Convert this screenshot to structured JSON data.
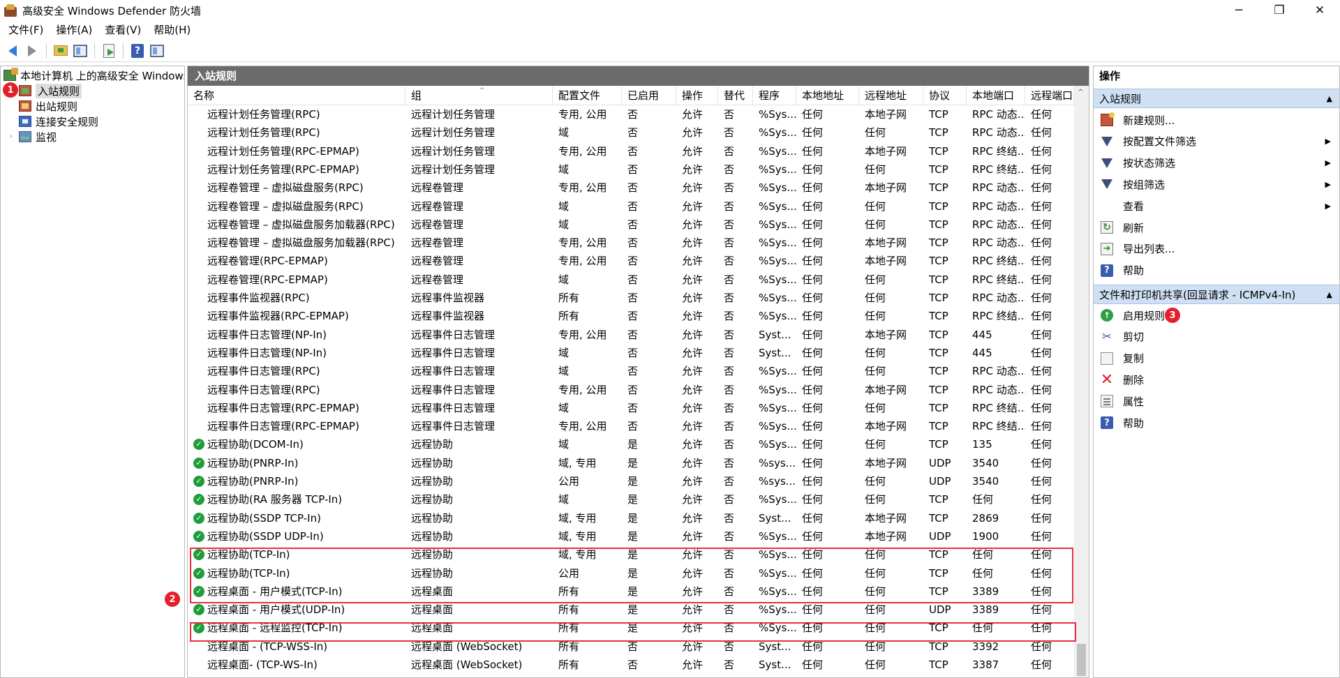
{
  "window": {
    "title": "高级安全 Windows Defender 防火墙",
    "minimize_glyph": "─",
    "maximize_glyph": "❐",
    "close_glyph": "✕"
  },
  "menu": [
    "文件(F)",
    "操作(A)",
    "查看(V)",
    "帮助(H)"
  ],
  "toolbar": {
    "icons": [
      "back-arrow-icon",
      "forward-arrow-icon",
      "up-folder-icon",
      "show-hide-tree-icon",
      "export-list-icon",
      "help-icon",
      "show-hide-action-pane-icon"
    ]
  },
  "tree": {
    "root": "本地计算机 上的高级安全 Windows Defender 防火墙",
    "items": [
      {
        "label": "入站规则",
        "icon": "inbound-rules-icon",
        "selected": true
      },
      {
        "label": "出站规则",
        "icon": "outbound-rules-icon"
      },
      {
        "label": "连接安全规则",
        "icon": "connection-security-icon"
      },
      {
        "label": "监视",
        "icon": "monitor-icon",
        "expander": "›"
      }
    ]
  },
  "annotations": {
    "badge1": "1",
    "badge2": "2",
    "badge3": "3",
    "highlight_color": "#e5303a"
  },
  "center": {
    "title": "入站规则",
    "columns": [
      "名称",
      "组",
      "配置文件",
      "已启用",
      "操作",
      "替代",
      "程序",
      "本地地址",
      "远程地址",
      "协议",
      "本地端口",
      "远程端口"
    ],
    "rows": [
      {
        "enabled_icon": false,
        "cells": [
          "远程计划任务管理(RPC)",
          "远程计划任务管理",
          "专用, 公用",
          "否",
          "允许",
          "否",
          "%Sys...",
          "任何",
          "本地子网",
          "TCP",
          "RPC 动态...",
          "任何"
        ]
      },
      {
        "enabled_icon": false,
        "cells": [
          "远程计划任务管理(RPC)",
          "远程计划任务管理",
          "域",
          "否",
          "允许",
          "否",
          "%Sys...",
          "任何",
          "任何",
          "TCP",
          "RPC 动态...",
          "任何"
        ]
      },
      {
        "enabled_icon": false,
        "cells": [
          "远程计划任务管理(RPC-EPMAP)",
          "远程计划任务管理",
          "专用, 公用",
          "否",
          "允许",
          "否",
          "%Sys...",
          "任何",
          "本地子网",
          "TCP",
          "RPC 终结...",
          "任何"
        ]
      },
      {
        "enabled_icon": false,
        "cells": [
          "远程计划任务管理(RPC-EPMAP)",
          "远程计划任务管理",
          "域",
          "否",
          "允许",
          "否",
          "%Sys...",
          "任何",
          "任何",
          "TCP",
          "RPC 终结...",
          "任何"
        ]
      },
      {
        "enabled_icon": false,
        "cells": [
          "远程卷管理 – 虚拟磁盘服务(RPC)",
          "远程卷管理",
          "专用, 公用",
          "否",
          "允许",
          "否",
          "%Sys...",
          "任何",
          "本地子网",
          "TCP",
          "RPC 动态...",
          "任何"
        ]
      },
      {
        "enabled_icon": false,
        "cells": [
          "远程卷管理 – 虚拟磁盘服务(RPC)",
          "远程卷管理",
          "域",
          "否",
          "允许",
          "否",
          "%Sys...",
          "任何",
          "任何",
          "TCP",
          "RPC 动态...",
          "任何"
        ]
      },
      {
        "enabled_icon": false,
        "cells": [
          "远程卷管理 – 虚拟磁盘服务加载器(RPC)",
          "远程卷管理",
          "域",
          "否",
          "允许",
          "否",
          "%Sys...",
          "任何",
          "任何",
          "TCP",
          "RPC 动态...",
          "任何"
        ]
      },
      {
        "enabled_icon": false,
        "cells": [
          "远程卷管理 – 虚拟磁盘服务加载器(RPC)",
          "远程卷管理",
          "专用, 公用",
          "否",
          "允许",
          "否",
          "%Sys...",
          "任何",
          "本地子网",
          "TCP",
          "RPC 动态...",
          "任何"
        ]
      },
      {
        "enabled_icon": false,
        "cells": [
          "远程卷管理(RPC-EPMAP)",
          "远程卷管理",
          "专用, 公用",
          "否",
          "允许",
          "否",
          "%Sys...",
          "任何",
          "本地子网",
          "TCP",
          "RPC 终结...",
          "任何"
        ]
      },
      {
        "enabled_icon": false,
        "cells": [
          "远程卷管理(RPC-EPMAP)",
          "远程卷管理",
          "域",
          "否",
          "允许",
          "否",
          "%Sys...",
          "任何",
          "任何",
          "TCP",
          "RPC 终结...",
          "任何"
        ]
      },
      {
        "enabled_icon": false,
        "cells": [
          "远程事件监视器(RPC)",
          "远程事件监视器",
          "所有",
          "否",
          "允许",
          "否",
          "%Sys...",
          "任何",
          "任何",
          "TCP",
          "RPC 动态...",
          "任何"
        ]
      },
      {
        "enabled_icon": false,
        "cells": [
          "远程事件监视器(RPC-EPMAP)",
          "远程事件监视器",
          "所有",
          "否",
          "允许",
          "否",
          "%Sys...",
          "任何",
          "任何",
          "TCP",
          "RPC 终结...",
          "任何"
        ]
      },
      {
        "enabled_icon": false,
        "cells": [
          "远程事件日志管理(NP-In)",
          "远程事件日志管理",
          "专用, 公用",
          "否",
          "允许",
          "否",
          "Syst...",
          "任何",
          "本地子网",
          "TCP",
          "445",
          "任何"
        ]
      },
      {
        "enabled_icon": false,
        "cells": [
          "远程事件日志管理(NP-In)",
          "远程事件日志管理",
          "域",
          "否",
          "允许",
          "否",
          "Syst...",
          "任何",
          "任何",
          "TCP",
          "445",
          "任何"
        ]
      },
      {
        "enabled_icon": false,
        "cells": [
          "远程事件日志管理(RPC)",
          "远程事件日志管理",
          "域",
          "否",
          "允许",
          "否",
          "%Sys...",
          "任何",
          "任何",
          "TCP",
          "RPC 动态...",
          "任何"
        ]
      },
      {
        "enabled_icon": false,
        "cells": [
          "远程事件日志管理(RPC)",
          "远程事件日志管理",
          "专用, 公用",
          "否",
          "允许",
          "否",
          "%Sys...",
          "任何",
          "本地子网",
          "TCP",
          "RPC 动态...",
          "任何"
        ]
      },
      {
        "enabled_icon": false,
        "cells": [
          "远程事件日志管理(RPC-EPMAP)",
          "远程事件日志管理",
          "域",
          "否",
          "允许",
          "否",
          "%Sys...",
          "任何",
          "任何",
          "TCP",
          "RPC 终结...",
          "任何"
        ]
      },
      {
        "enabled_icon": false,
        "cells": [
          "远程事件日志管理(RPC-EPMAP)",
          "远程事件日志管理",
          "专用, 公用",
          "否",
          "允许",
          "否",
          "%Sys...",
          "任何",
          "本地子网",
          "TCP",
          "RPC 终结...",
          "任何"
        ]
      },
      {
        "enabled_icon": true,
        "cells": [
          "远程协助(DCOM-In)",
          "远程协助",
          "域",
          "是",
          "允许",
          "否",
          "%Sys...",
          "任何",
          "任何",
          "TCP",
          "135",
          "任何"
        ]
      },
      {
        "enabled_icon": true,
        "cells": [
          "远程协助(PNRP-In)",
          "远程协助",
          "域, 专用",
          "是",
          "允许",
          "否",
          "%sys...",
          "任何",
          "本地子网",
          "UDP",
          "3540",
          "任何"
        ]
      },
      {
        "enabled_icon": true,
        "cells": [
          "远程协助(PNRP-In)",
          "远程协助",
          "公用",
          "是",
          "允许",
          "否",
          "%sys...",
          "任何",
          "任何",
          "UDP",
          "3540",
          "任何"
        ]
      },
      {
        "enabled_icon": true,
        "cells": [
          "远程协助(RA 服务器 TCP-In)",
          "远程协助",
          "域",
          "是",
          "允许",
          "否",
          "%Sys...",
          "任何",
          "任何",
          "TCP",
          "任何",
          "任何"
        ]
      },
      {
        "enabled_icon": true,
        "cells": [
          "远程协助(SSDP TCP-In)",
          "远程协助",
          "域, 专用",
          "是",
          "允许",
          "否",
          "Syst...",
          "任何",
          "本地子网",
          "TCP",
          "2869",
          "任何"
        ]
      },
      {
        "enabled_icon": true,
        "cells": [
          "远程协助(SSDP UDP-In)",
          "远程协助",
          "域, 专用",
          "是",
          "允许",
          "否",
          "%Sys...",
          "任何",
          "本地子网",
          "UDP",
          "1900",
          "任何"
        ]
      },
      {
        "enabled_icon": true,
        "cells": [
          "远程协助(TCP-In)",
          "远程协助",
          "域, 专用",
          "是",
          "允许",
          "否",
          "%Sys...",
          "任何",
          "任何",
          "TCP",
          "任何",
          "任何"
        ]
      },
      {
        "enabled_icon": true,
        "cells": [
          "远程协助(TCP-In)",
          "远程协助",
          "公用",
          "是",
          "允许",
          "否",
          "%Sys...",
          "任何",
          "任何",
          "TCP",
          "任何",
          "任何"
        ]
      },
      {
        "enabled_icon": true,
        "cells": [
          "远程桌面 - 用户模式(TCP-In)",
          "远程桌面",
          "所有",
          "是",
          "允许",
          "否",
          "%Sys...",
          "任何",
          "任何",
          "TCP",
          "3389",
          "任何"
        ]
      },
      {
        "enabled_icon": true,
        "cells": [
          "远程桌面 - 用户模式(UDP-In)",
          "远程桌面",
          "所有",
          "是",
          "允许",
          "否",
          "%Sys...",
          "任何",
          "任何",
          "UDP",
          "3389",
          "任何"
        ]
      },
      {
        "enabled_icon": true,
        "cells": [
          "远程桌面 - 远程监控(TCP-In)",
          "远程桌面",
          "所有",
          "是",
          "允许",
          "否",
          "%Sys...",
          "任何",
          "任何",
          "TCP",
          "任何",
          "任何"
        ]
      },
      {
        "enabled_icon": false,
        "cells": [
          "远程桌面 - (TCP-WSS-In)",
          "远程桌面 (WebSocket)",
          "所有",
          "否",
          "允许",
          "否",
          "Syst...",
          "任何",
          "任何",
          "TCP",
          "3392",
          "任何"
        ]
      },
      {
        "enabled_icon": false,
        "cells": [
          "远程桌面- (TCP-WS-In)",
          "远程桌面 (WebSocket)",
          "所有",
          "否",
          "允许",
          "否",
          "Syst...",
          "任何",
          "任何",
          "TCP",
          "3387",
          "任何"
        ]
      }
    ]
  },
  "actions": {
    "title": "操作",
    "section1": {
      "title": "入站规则",
      "items": [
        {
          "label": "新建规则...",
          "icon": "new-rule-icon"
        },
        {
          "label": "按配置文件筛选",
          "icon": "filter-icon",
          "submenu": true
        },
        {
          "label": "按状态筛选",
          "icon": "filter-icon",
          "submenu": true
        },
        {
          "label": "按组筛选",
          "icon": "filter-icon",
          "submenu": true
        },
        {
          "label": "查看",
          "icon": "",
          "submenu": true
        },
        {
          "label": "刷新",
          "icon": "refresh-icon"
        },
        {
          "label": "导出列表...",
          "icon": "export-icon"
        },
        {
          "label": "帮助",
          "icon": "help-icon"
        }
      ]
    },
    "section2": {
      "title": "文件和打印机共享(回显请求 - ICMPv4-In)",
      "items": [
        {
          "label": "启用规则",
          "icon": "enable-rule-icon"
        },
        {
          "label": "剪切",
          "icon": "cut-icon"
        },
        {
          "label": "复制",
          "icon": "copy-icon"
        },
        {
          "label": "删除",
          "icon": "delete-icon"
        },
        {
          "label": "属性",
          "icon": "properties-icon"
        },
        {
          "label": "帮助",
          "icon": "help-icon"
        }
      ]
    }
  }
}
